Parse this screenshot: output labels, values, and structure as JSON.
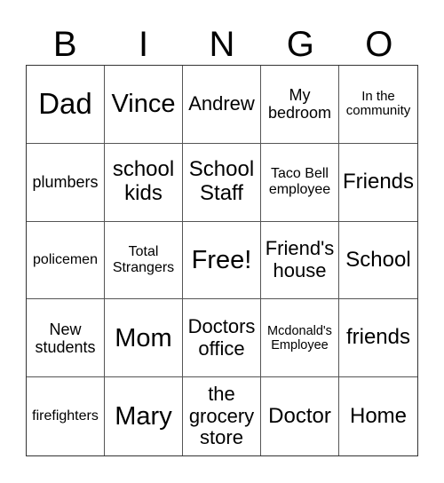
{
  "header": {
    "letters": [
      "B",
      "I",
      "N",
      "G",
      "O"
    ]
  },
  "cells": [
    {
      "text": "Dad",
      "size": "s-xl"
    },
    {
      "text": "Vince",
      "size": "s-l"
    },
    {
      "text": "Andrew",
      "size": "s-ml"
    },
    {
      "text": "My\nbedroom",
      "size": "s-sm"
    },
    {
      "text": "In the\ncommunity",
      "size": "s-xs"
    },
    {
      "text": "plumbers",
      "size": "s-sm"
    },
    {
      "text": "school\nkids",
      "size": "s-m"
    },
    {
      "text": "School\nStaff",
      "size": "s-m"
    },
    {
      "text": "Taco Bell\nemployee",
      "size": "s-s"
    },
    {
      "text": "Friends",
      "size": "s-m"
    },
    {
      "text": "policemen",
      "size": "s-s"
    },
    {
      "text": "Total\nStrangers",
      "size": "s-s"
    },
    {
      "text": "Free!",
      "size": "s-l"
    },
    {
      "text": "Friend's\nhouse",
      "size": "s-ml"
    },
    {
      "text": "School",
      "size": "s-m"
    },
    {
      "text": "New\nstudents",
      "size": "s-sm"
    },
    {
      "text": "Mom",
      "size": "s-l"
    },
    {
      "text": "Doctors\noffice",
      "size": "s-ml"
    },
    {
      "text": "Mcdonald's\nEmployee",
      "size": "s-xxs"
    },
    {
      "text": "friends",
      "size": "s-m"
    },
    {
      "text": "firefighters",
      "size": "s-s"
    },
    {
      "text": "Mary",
      "size": "s-l"
    },
    {
      "text": "the\ngrocery\nstore",
      "size": "s-ml"
    },
    {
      "text": "Doctor",
      "size": "s-m"
    },
    {
      "text": "Home",
      "size": "s-m"
    }
  ]
}
